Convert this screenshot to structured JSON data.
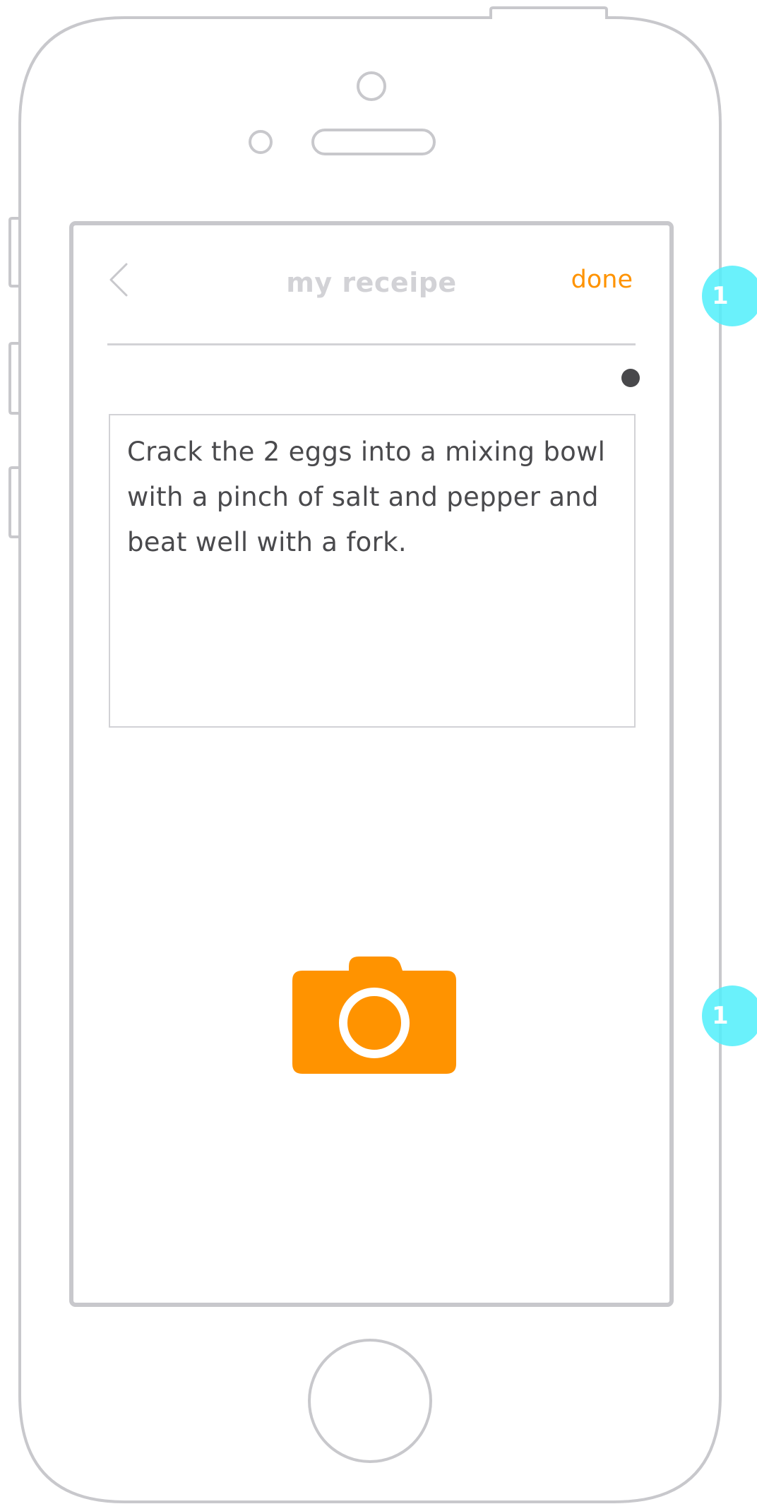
{
  "nav": {
    "back_icon": "chevron-left-icon",
    "title": "my receipe",
    "done_label": "done"
  },
  "recipe": {
    "step_text": "Crack the 2 eggs into a mixing bowl with a pinch of salt and pepper and beat well with a fork."
  },
  "camera": {
    "icon": "camera-icon"
  },
  "page_indicator": {
    "icon": "dot-icon"
  },
  "annotations": {
    "top": "1",
    "bottom": "1"
  },
  "colors": {
    "accent": "#ff9300",
    "frame": "#c8c8cc",
    "text": "#4a4a4d",
    "annotation": "#50effa"
  }
}
